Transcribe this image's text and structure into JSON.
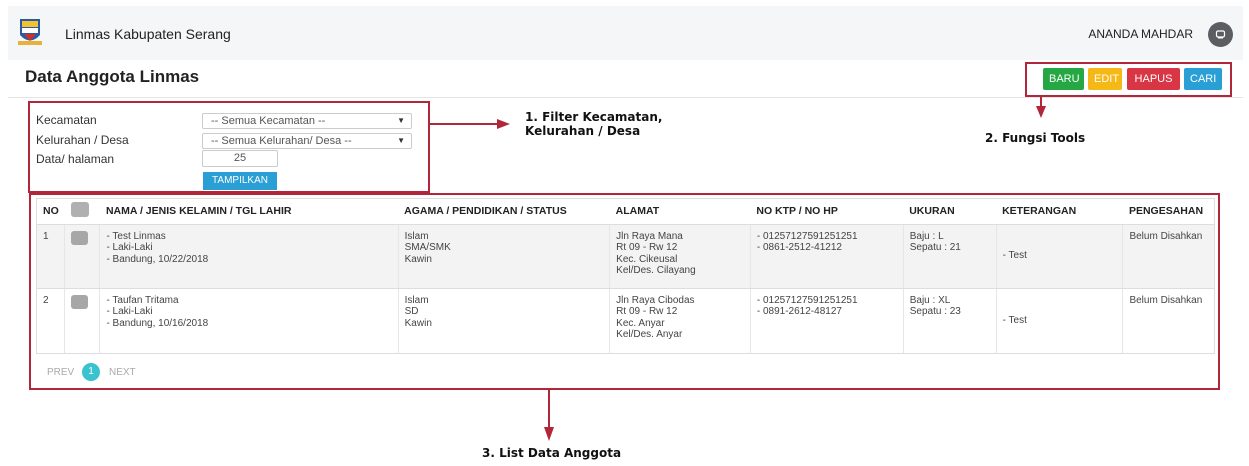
{
  "header": {
    "app_title": "Linmas Kabupaten Serang",
    "user_name": "ANANDA MAHDAR"
  },
  "page": {
    "title": "Data Anggota Linmas"
  },
  "toolbar": {
    "baru": "BARU",
    "edit": "EDIT",
    "hapus": "HAPUS",
    "cari": "CARI"
  },
  "filters": {
    "kecamatan_label": "Kecamatan",
    "kecamatan_value": "-- Semua Kecamatan --",
    "kelurahan_label": "Kelurahan / Desa",
    "kelurahan_value": "-- Semua Kelurahan/ Desa --",
    "per_page_label": "Data/ halaman",
    "per_page_value": "25",
    "submit": "TAMPILKAN"
  },
  "annotations": {
    "filter_line1": "1. Filter Kecamatan,",
    "filter_line2": "Kelurahan / Desa",
    "tools": "2. Fungsi Tools",
    "list": "3. List Data Anggota"
  },
  "table": {
    "headers": [
      "NO",
      "NAMA / JENIS KELAMIN / TGL LAHIR",
      "AGAMA / PENDIDIKAN / STATUS",
      "ALAMAT",
      "NO KTP / NO HP",
      "UKURAN",
      "KETERANGAN",
      "PENGESAHAN"
    ],
    "rows": [
      {
        "no": "1",
        "nama": "- Test Linmas",
        "jk": "- Laki-Laki",
        "ttl": "- Bandung, 10/22/2018",
        "agama": "Islam",
        "pendidikan": "SMA/SMK",
        "status": "Kawin",
        "alamat1": "Jln Raya Mana",
        "alamat2": "Rt 09 - Rw 12",
        "alamat3": "Kec. Cikeusal",
        "alamat4": "Kel/Des. Cilayang",
        "ktp": "- 01257127591251251",
        "hp": "- 0861-2512-41212",
        "baju": "Baju : L",
        "sepatu": "Sepatu : 21",
        "keterangan": "- Test",
        "pengesahan": "Belum Disahkan"
      },
      {
        "no": "2",
        "nama": "- Taufan Tritama",
        "jk": "- Laki-Laki",
        "ttl": "- Bandung, 10/16/2018",
        "agama": "Islam",
        "pendidikan": "SD",
        "status": "Kawin",
        "alamat1": "Jln Raya Cibodas",
        "alamat2": "Rt 09 - Rw 12",
        "alamat3": "Kec. Anyar",
        "alamat4": "Kel/Des. Anyar",
        "ktp": "- 01257127591251251",
        "hp": "- 0891-2612-48127",
        "baju": "Baju : XL",
        "sepatu": "Sepatu : 23",
        "keterangan": "- Test",
        "pengesahan": "Belum Disahkan"
      }
    ]
  },
  "pagination": {
    "prev": "PREV",
    "current": "1",
    "next": "NEXT"
  },
  "colors": {
    "annotation": "#b2263a",
    "baru": "#25a844",
    "edit": "#f6b817",
    "hapus": "#d83545",
    "cari": "#2a9fd6",
    "page_active": "#3bc2cf"
  }
}
